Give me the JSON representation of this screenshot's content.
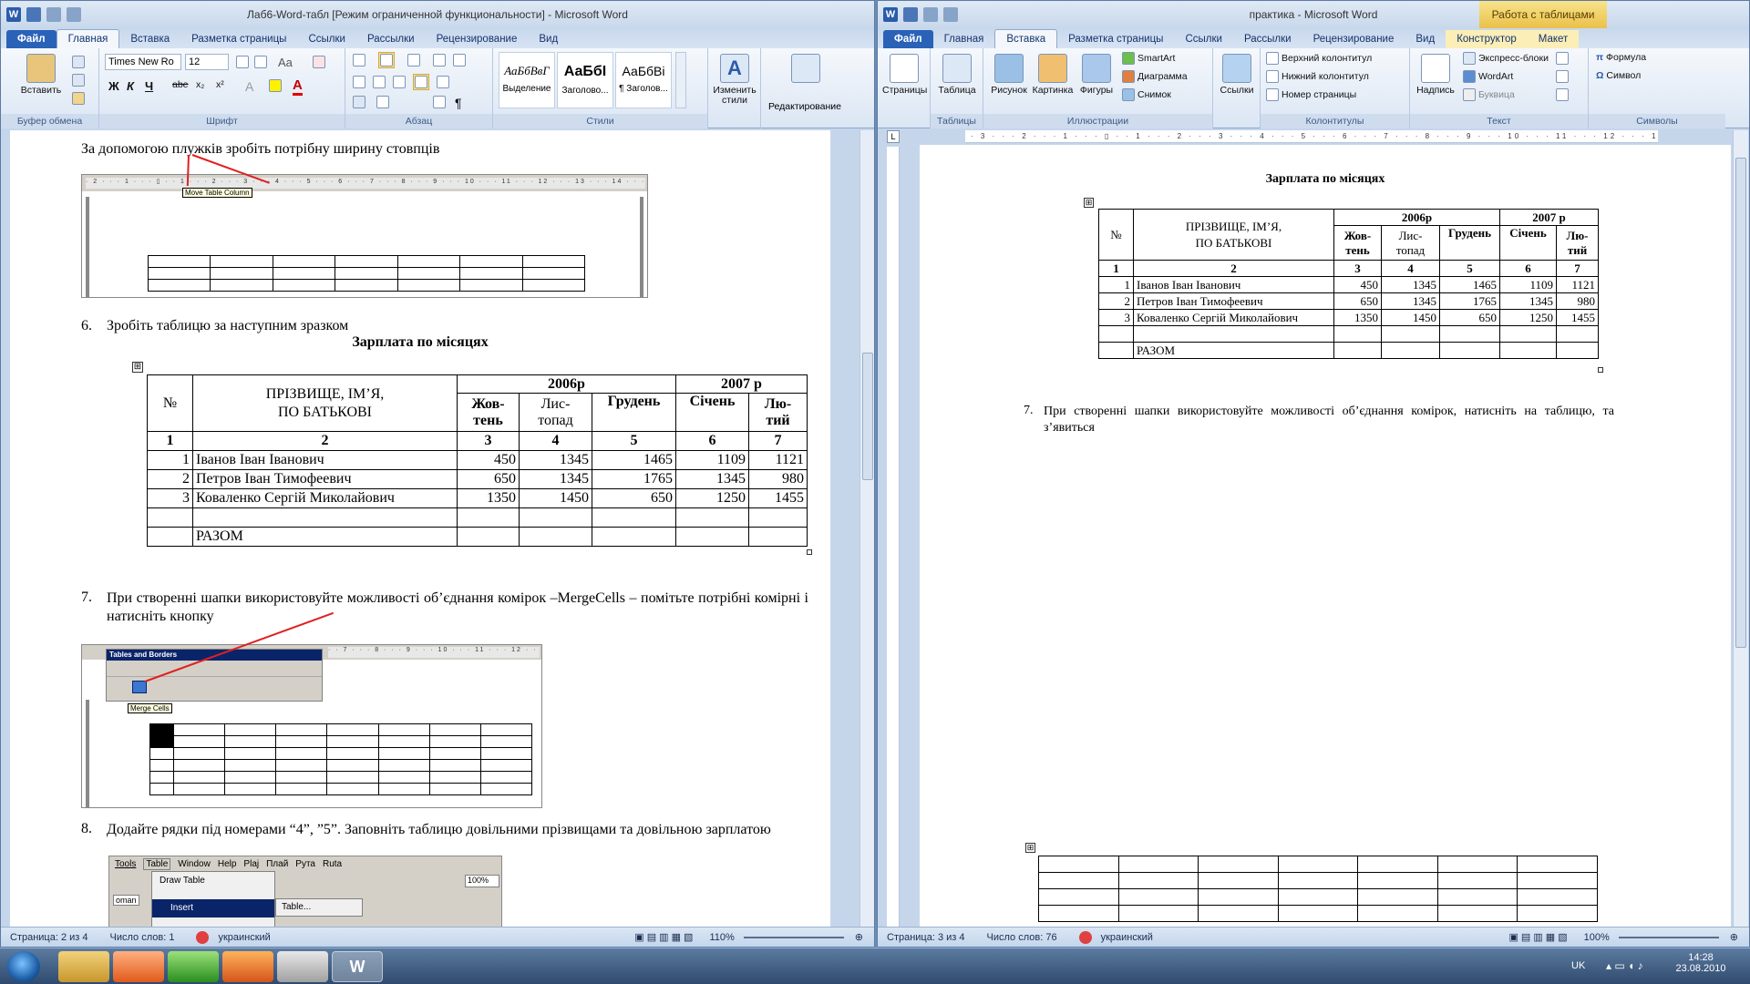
{
  "left_window": {
    "title": "Лаб6-Word-табл [Режим ограниченной функциональности] - Microsoft Word",
    "tabs": [
      "Файл",
      "Главная",
      "Вставка",
      "Разметка страницы",
      "Ссылки",
      "Рассылки",
      "Рецензирование",
      "Вид"
    ],
    "ribbon": {
      "paste": "Вставить",
      "font_name": "Times New Ro",
      "font_size": "12",
      "bold": "Ж",
      "italic": "К",
      "underline": "Ч",
      "strike": "abe",
      "subscript": "x₂",
      "superscript": "x²",
      "font_color": "A",
      "change_case": "Aa",
      "styles": [
        {
          "preview": "АаБбВвГ",
          "name": "Выделение"
        },
        {
          "preview": "АаБбІ",
          "name": "Заголово..."
        },
        {
          "preview": "АаБбВі",
          "name": "¶ Заголов..."
        }
      ],
      "change_styles": "Изменить стили",
      "editing": "Редактирование",
      "groups": [
        "Буфер обмена",
        "Шрифт",
        "Абзац",
        "Стили"
      ],
      "pilcrow": "¶"
    },
    "document": {
      "line1": "За допомогою плужків зробіть потрібну ширину стовпців",
      "tooltip_move_col": "Move Table Column",
      "item6_num": "6.",
      "item6_text": "Зробіть таблицю за наступним зразком",
      "table_title": "Зарплата по місяцях",
      "item7_num": "7.",
      "item7_text": "При створенні шапки використовуйте можливості об’єднання комірок –MergeCells – помітьте потрібні комірні і натисніть кнопку",
      "tables_borders_title": "Tables and Borders",
      "merge_cells_tip": "Merge Cells",
      "item8_num": "8.",
      "item8_text": "Додайте рядки під номерами “4”, ”5”. Заповніть таблицю довільними прізвищами та довільною зарплатою",
      "menu_items": [
        "Tools",
        "Table",
        "Window",
        "Help",
        "Plaj",
        "Плай",
        "Рута",
        "Ruta"
      ],
      "draw_table": "Draw Table",
      "insert": "Insert",
      "table_dots": "Table...",
      "roman": "oman",
      "zoom_box": "100%",
      "ruler_ticks": "· 2 · · · 1 · · · ▯ · · 1 · · · 2 · · · 3 · · · 4 · · · 5 · · · 6 · · · 7 · · · 8 · · · 9 · · · 10 · · · 11 · · · 12 · · · 13 · · · 14 · · · 15 · · · 16 · · · 17",
      "ruler_ticks_short": "· · 7 · · · 8 · · · 9 · · · 10 · · · 11 · · · 12 · · · 13 · · · 14"
    },
    "status": {
      "page": "Страница: 2 из 4",
      "words": "Число слов: 1",
      "lang": "украинский",
      "zoom": "110%"
    }
  },
  "right_window": {
    "title": "практика - Microsoft Word",
    "context_tab_group": "Работа с таблицами",
    "tabs": [
      "Файл",
      "Главная",
      "Вставка",
      "Разметка страницы",
      "Ссылки",
      "Рассылки",
      "Рецензирование",
      "Вид",
      "Конструктор",
      "Макет"
    ],
    "ribbon": {
      "pages": "Страницы",
      "table": "Таблица",
      "picture": "Рисунок",
      "clipart": "Картинка",
      "shapes": "Фигуры",
      "smartart": "SmartArt",
      "chart": "Диаграмма",
      "screenshot": "Снимок",
      "links": "Ссылки",
      "header": "Верхний колонтитул",
      "footer": "Нижний колонтитул",
      "page_number": "Номер страницы",
      "textbox": "Надпись",
      "quickparts": "Экспресс-блоки",
      "wordart": "WordArt",
      "dropcap": "Буквица",
      "equation": "Формула",
      "symbol": "Символ",
      "groups": [
        "Таблицы",
        "Иллюстрации",
        "Колонтитулы",
        "Текст",
        "Символы"
      ]
    },
    "ruler_ticks": "· 3 · · · 2 · · · 1 · · · ▯ · · 1 · · · 2 · · · 3 · · · 4 · · · 5 · · · 6 · · · 7 · · · 8 · · · 9 · · · 10 · · · 11 · · · 12 · · · 13 · · · 14 · · · 15 · · · 16 · · · 17",
    "document": {
      "table_title": "Зарплата по місяцях",
      "item7_num": "7.",
      "item7_text": "При створенні шапки використовуйте можливості об’єднання комірок, натисніть на таблицю, та з’явиться"
    },
    "status": {
      "page": "Страница: 3 из 4",
      "words": "Число слов: 76",
      "lang": "украинский",
      "zoom": "100%"
    }
  },
  "salary_table": {
    "col_num": "№",
    "col_name_line1": "ПРІЗВИЩЕ, ІМ’Я,",
    "col_name_line2": "ПО БАТЬКОВІ",
    "year1": "2006р",
    "year2": "2007 р",
    "months": [
      [
        "Жов-",
        "тень"
      ],
      [
        "Лис-",
        "топад"
      ],
      [
        "Грудень",
        ""
      ],
      [
        "Січень",
        ""
      ],
      [
        "Лю-",
        "тий"
      ]
    ],
    "numbers": [
      "1",
      "2",
      "3",
      "4",
      "5",
      "6",
      "7"
    ],
    "rows": [
      [
        "1",
        "Іванов Іван Іванович",
        "450",
        "1345",
        "1465",
        "1109",
        "1121"
      ],
      [
        "2",
        "Петров Іван Тимофеевич",
        "650",
        "1345",
        "1765",
        "1345",
        "980"
      ],
      [
        "3",
        "Коваленко Сергій Миколайович",
        "1350",
        "1450",
        "650",
        "1250",
        "1455"
      ]
    ],
    "total_label": "РАЗОМ"
  },
  "taskbar": {
    "lang": "UK",
    "time": "14:28",
    "date": "23.08.2010"
  }
}
